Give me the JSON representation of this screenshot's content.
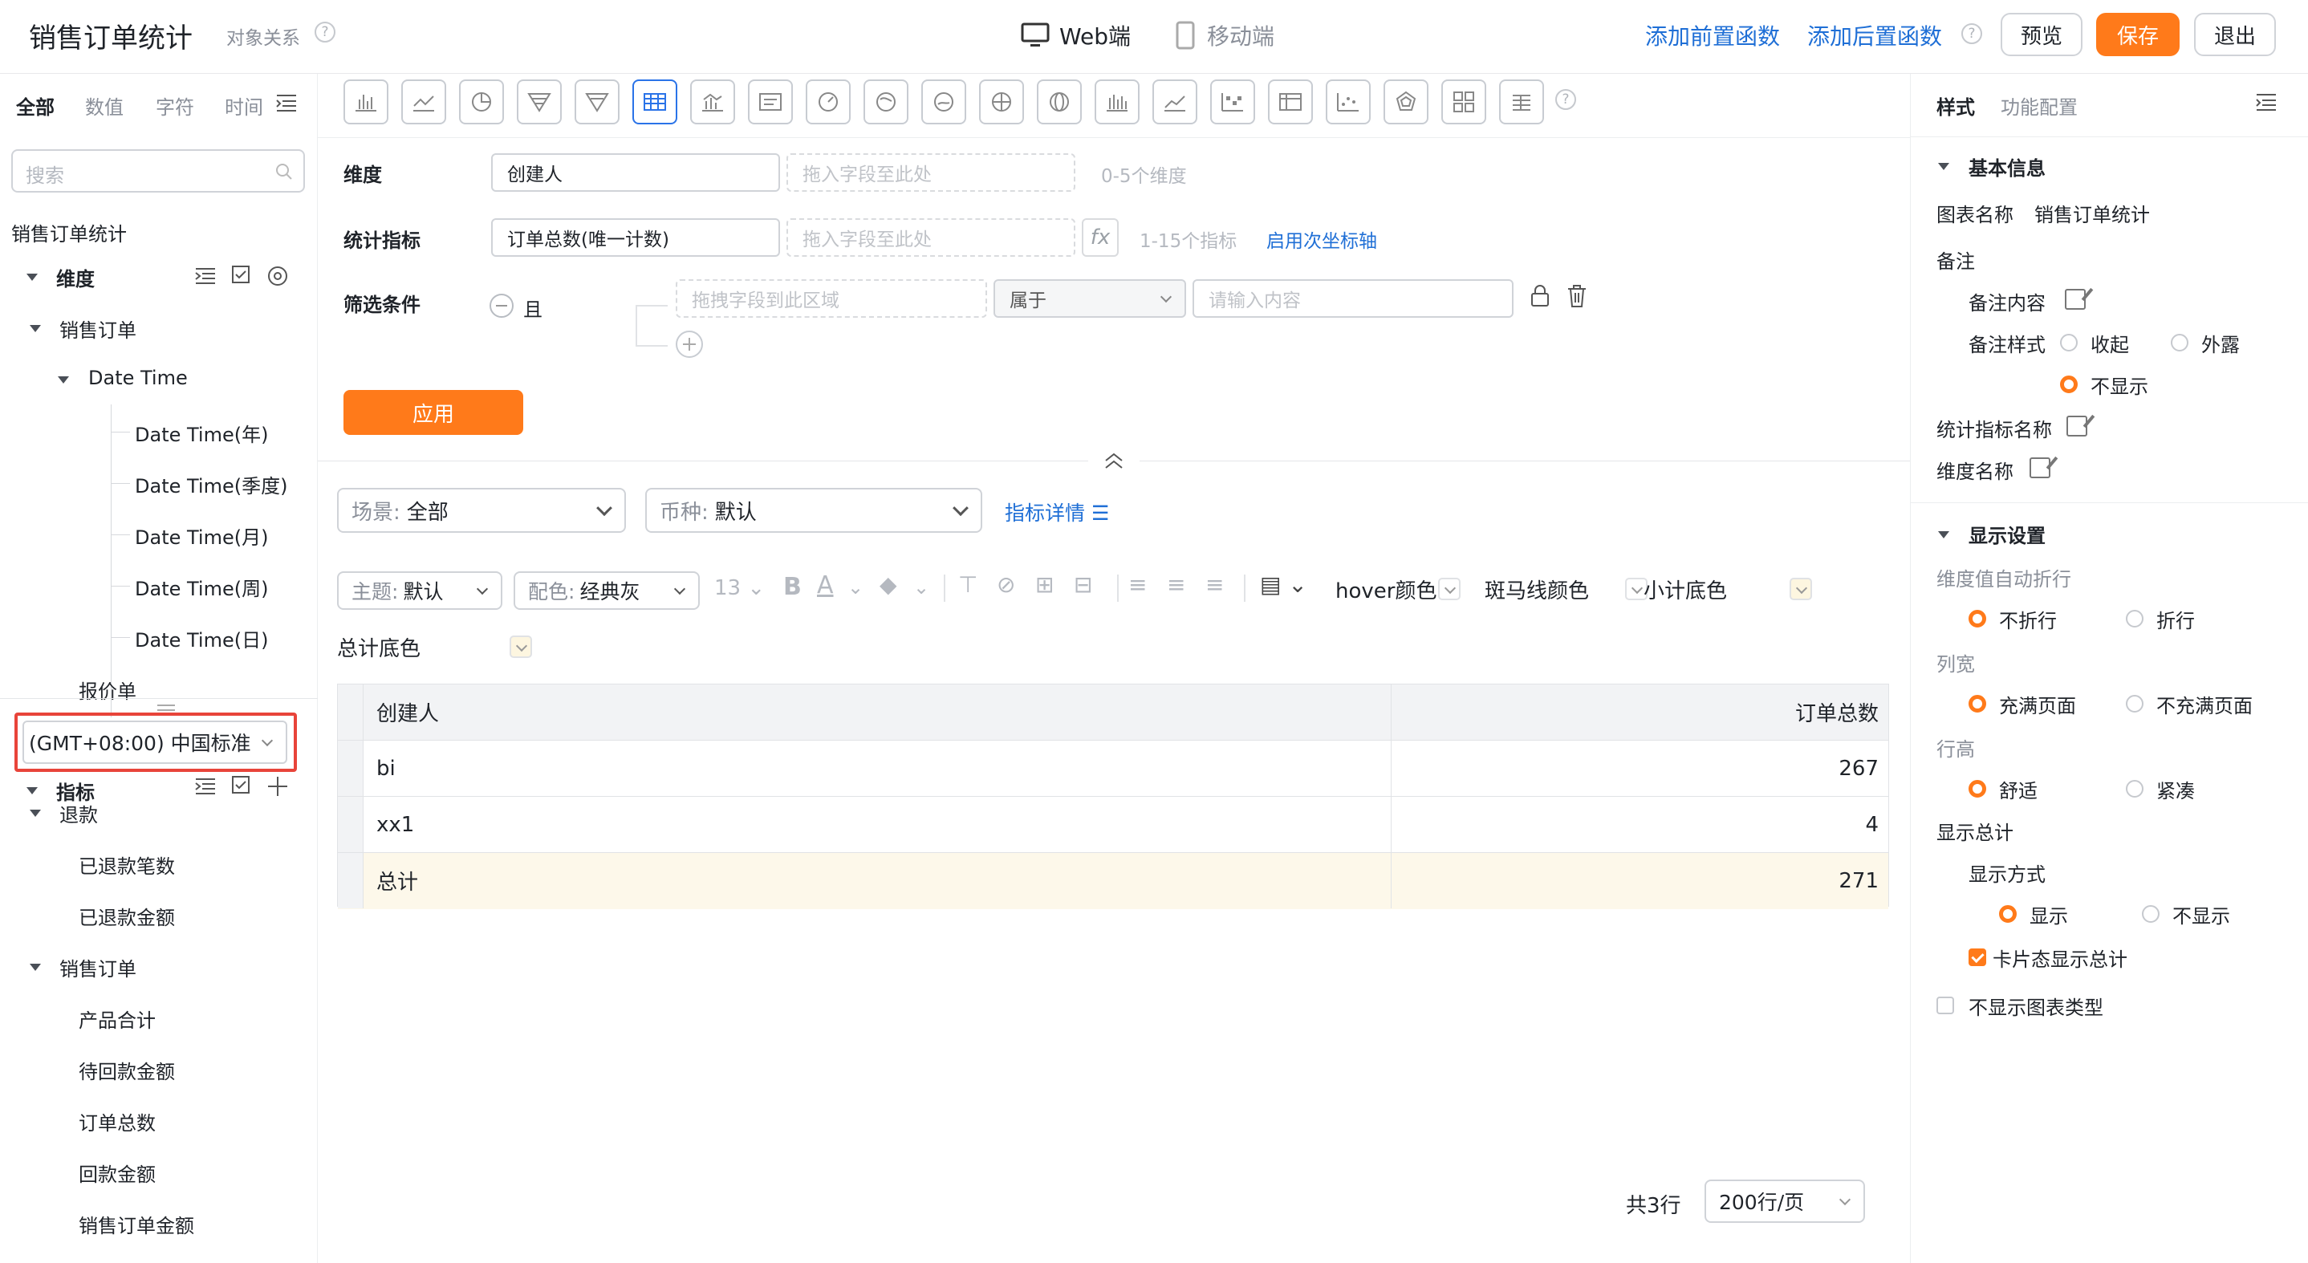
{
  "header": {
    "title": "销售订单统计",
    "relation": "对象关系",
    "web": "Web端",
    "mobile": "移动端",
    "pre_func": "添加前置函数",
    "post_func": "添加后置函数",
    "preview": "预览",
    "save": "保存",
    "exit": "退出"
  },
  "left": {
    "tabs": [
      "全部",
      "数值",
      "字符",
      "时间"
    ],
    "search_placeholder": "搜索",
    "source": "销售订单统计",
    "dim_title": "维度",
    "sales_order": "销售订单",
    "datetime": "Date Time",
    "datetime_children": [
      "Date Time(年)",
      "Date Time(季度)",
      "Date Time(月)",
      "Date Time(周)",
      "Date Time(日)"
    ],
    "quote": "报价单",
    "timezone": "(GMT+08:00) 中国标准",
    "metric_title": "指标",
    "refund": "退款",
    "refund_children": [
      "已退款笔数",
      "已退款金额"
    ],
    "sales_order2": "销售订单",
    "sales_children": [
      "产品合计",
      "待回款金额",
      "订单总数",
      "回款金额",
      "销售订单金额"
    ]
  },
  "config": {
    "dim_label": "维度",
    "dim_value": "创建人",
    "drop_placeholder": "拖入字段至此处",
    "dim_hint": "0-5个维度",
    "metric_label": "统计指标",
    "metric_value": "订单总数(唯一计数)",
    "metric_hint": "1-15个指标",
    "secondary_axis": "启用次坐标轴",
    "filter_label": "筛选条件",
    "and": "且",
    "filter_drag": "拖拽字段到此区域",
    "op": "属于",
    "input_placeholder": "请输入内容",
    "apply": "应用"
  },
  "controls": {
    "scene_label": "场景:",
    "scene": "全部",
    "currency_label": "币种:",
    "currency": "默认",
    "detail": "指标详情"
  },
  "style_bar": {
    "theme_label": "主题:",
    "theme": "默认",
    "palette_label": "配色:",
    "palette": "经典灰",
    "font_size": "13",
    "hover": "hover颜色",
    "zebra": "斑马线颜色",
    "subtotal": "小计底色",
    "total": "总计底色"
  },
  "table": {
    "headers": [
      "创建人",
      "订单总数"
    ],
    "rows": [
      [
        "bi",
        "267"
      ],
      [
        "xx1",
        "4"
      ]
    ],
    "total": [
      "总计",
      "271"
    ]
  },
  "pagination": {
    "count": "共3行",
    "per_page": "200行/页"
  },
  "right": {
    "tabs": [
      "样式",
      "功能配置"
    ],
    "basic": "基本信息",
    "chart_name_label": "图表名称",
    "chart_name": "销售订单统计",
    "remark": "备注",
    "remark_content": "备注内容",
    "remark_style": "备注样式",
    "collapse": "收起",
    "expose": "外露",
    "hide": "不显示",
    "metric_name": "统计指标名称",
    "dim_name": "维度名称",
    "display": "显示设置",
    "wrap": "维度值自动折行",
    "nowrap": "不折行",
    "dowrap": "折行",
    "colwidth": "列宽",
    "fill": "充满页面",
    "nofill": "不充满页面",
    "rowheight": "行高",
    "comfort": "舒适",
    "compact": "紧凑",
    "showtotal": "显示总计",
    "showmode": "显示方式",
    "show": "显示",
    "noshow": "不显示",
    "card_total": "卡片态显示总计",
    "no_chart_type": "不显示图表类型"
  },
  "colors": {
    "accent": "#ff7a1a",
    "link": "#1f6fd6",
    "highlight_box": "#e8443a"
  }
}
